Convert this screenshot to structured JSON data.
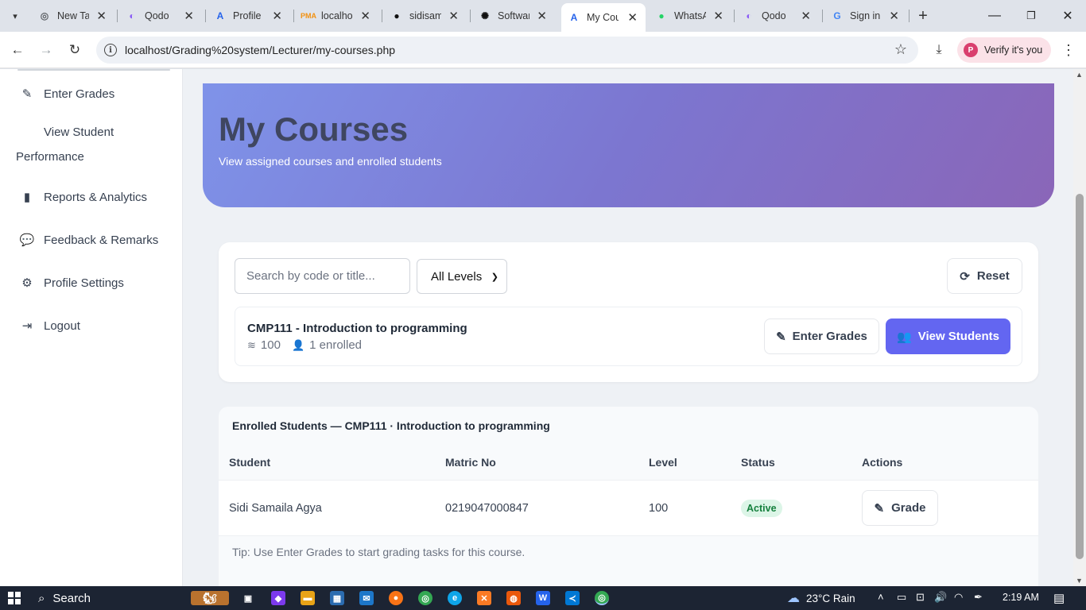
{
  "browser": {
    "tabs": [
      {
        "title": "New Ta",
        "icon": "chrome-icon"
      },
      {
        "title": "Qodo",
        "icon": "qodo-icon"
      },
      {
        "title": "Profile",
        "icon": "app-a-icon"
      },
      {
        "title": "localho",
        "icon": "phpmyadmin-icon"
      },
      {
        "title": "sidisam",
        "icon": "github-icon"
      },
      {
        "title": "Softwar",
        "icon": "openai-icon"
      },
      {
        "title": "My Cou",
        "icon": "app-a-icon"
      },
      {
        "title": "WhatsA",
        "icon": "whatsapp-icon"
      },
      {
        "title": "Qodo",
        "icon": "qodo-icon"
      },
      {
        "title": "Sign in",
        "icon": "google-icon"
      }
    ],
    "active_tab_index": 6,
    "url": "localhost/Grading%20system/Lecturer/my-courses.php",
    "profile_label": "Verify it's you",
    "profile_initial": "P"
  },
  "sidebar": {
    "items": [
      {
        "label": "Enter Grades",
        "icon": "edit-icon"
      },
      {
        "label_line1": "View Student",
        "label_line2": "Performance"
      },
      {
        "label": "Reports & Analytics",
        "icon": "bar-chart-icon"
      },
      {
        "label": "Feedback & Remarks",
        "icon": "comments-icon"
      },
      {
        "label": "Profile Settings",
        "icon": "user-cog-icon"
      },
      {
        "label": "Logout",
        "icon": "logout-icon"
      }
    ]
  },
  "hero": {
    "title": "My Courses",
    "subtitle": "View assigned courses and enrolled students"
  },
  "filters": {
    "search_placeholder": "Search by code or title...",
    "level_selected": "All Levels",
    "reset_label": "Reset"
  },
  "course": {
    "title": "CMP111 - Introduction to programming",
    "level": "100",
    "enrolled": "1 enrolled",
    "enter_grades_label": "Enter Grades",
    "view_students_label": "View Students"
  },
  "enrolled": {
    "title": "Enrolled Students — CMP111 · Introduction to programming",
    "columns": [
      "Student",
      "Matric No",
      "Level",
      "Status",
      "Actions"
    ],
    "rows": [
      {
        "student": "Sidi Samaila Agya",
        "matric": "0219047000847",
        "level": "100",
        "status": "Active",
        "action": "Grade"
      }
    ],
    "tip": "Tip: Use Enter Grades to start grading tasks for this course."
  },
  "taskbar": {
    "search_label": "Search",
    "weather": "23°C  Rain",
    "time": "2:19 AM"
  },
  "colors": {
    "primary": "#6366f1",
    "active_badge_bg": "#dcf5e7",
    "active_badge_text": "#15803d"
  }
}
